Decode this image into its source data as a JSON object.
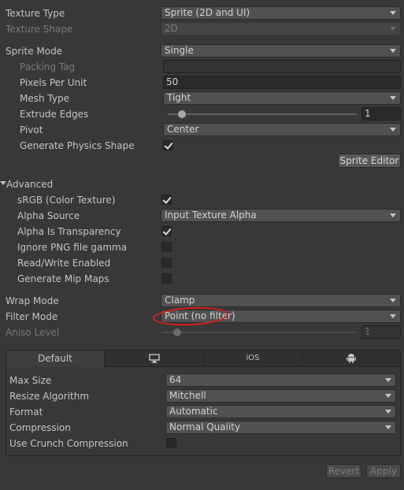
{
  "texture_type": {
    "label": "Texture Type",
    "value": "Sprite (2D and UI)"
  },
  "texture_shape": {
    "label": "Texture Shape",
    "value": "2D"
  },
  "sprite_mode": {
    "label": "Sprite Mode",
    "value": "Single"
  },
  "packing_tag": {
    "label": "Packing Tag",
    "value": ""
  },
  "pixels_per_unit": {
    "label": "Pixels Per Unit",
    "value": "50"
  },
  "mesh_type": {
    "label": "Mesh Type",
    "value": "Tight"
  },
  "extrude_edges": {
    "label": "Extrude Edges",
    "value": "1",
    "level": 0.0625
  },
  "pivot": {
    "label": "Pivot",
    "value": "Center"
  },
  "generate_physics_shape": {
    "label": "Generate Physics Shape",
    "checked": true
  },
  "sprite_editor_button": "Sprite Editor",
  "advanced": {
    "label": "Advanced",
    "srgb": {
      "label": "sRGB (Color Texture)",
      "checked": true
    },
    "alpha_source": {
      "label": "Alpha Source",
      "value": "Input Texture Alpha"
    },
    "alpha_is_transparency": {
      "label": "Alpha Is Transparency",
      "checked": true
    },
    "ignore_png_gamma": {
      "label": "Ignore PNG file gamma",
      "checked": false
    },
    "read_write": {
      "label": "Read/Write Enabled",
      "checked": false
    },
    "mip_maps": {
      "label": "Generate Mip Maps",
      "checked": false
    }
  },
  "wrap_mode": {
    "label": "Wrap Mode",
    "value": "Clamp"
  },
  "filter_mode": {
    "label": "Filter Mode",
    "value": "Point (no filter)"
  },
  "aniso_level": {
    "label": "Aniso Level",
    "value": "1",
    "level": 0.0
  },
  "platform_tabs": [
    {
      "label": "Default",
      "icon": null,
      "selected": true
    },
    {
      "label": "",
      "icon": "monitor-icon",
      "selected": false
    },
    {
      "label": "iOS",
      "icon": null,
      "selected": false
    },
    {
      "label": "",
      "icon": "android-icon",
      "selected": false
    }
  ],
  "platform_settings": {
    "max_size": {
      "label": "Max Size",
      "value": "64"
    },
    "resize_algorithm": {
      "label": "Resize Algorithm",
      "value": "Mitchell"
    },
    "format": {
      "label": "Format",
      "value": "Automatic"
    },
    "compression": {
      "label": "Compression",
      "value": "Normal Quality"
    },
    "crunch": {
      "label": "Use Crunch Compression",
      "checked": false
    }
  },
  "footer": {
    "revert": "Revert",
    "apply": "Apply"
  },
  "colors": {
    "annotation": "#d9201c",
    "background": "#383838"
  }
}
